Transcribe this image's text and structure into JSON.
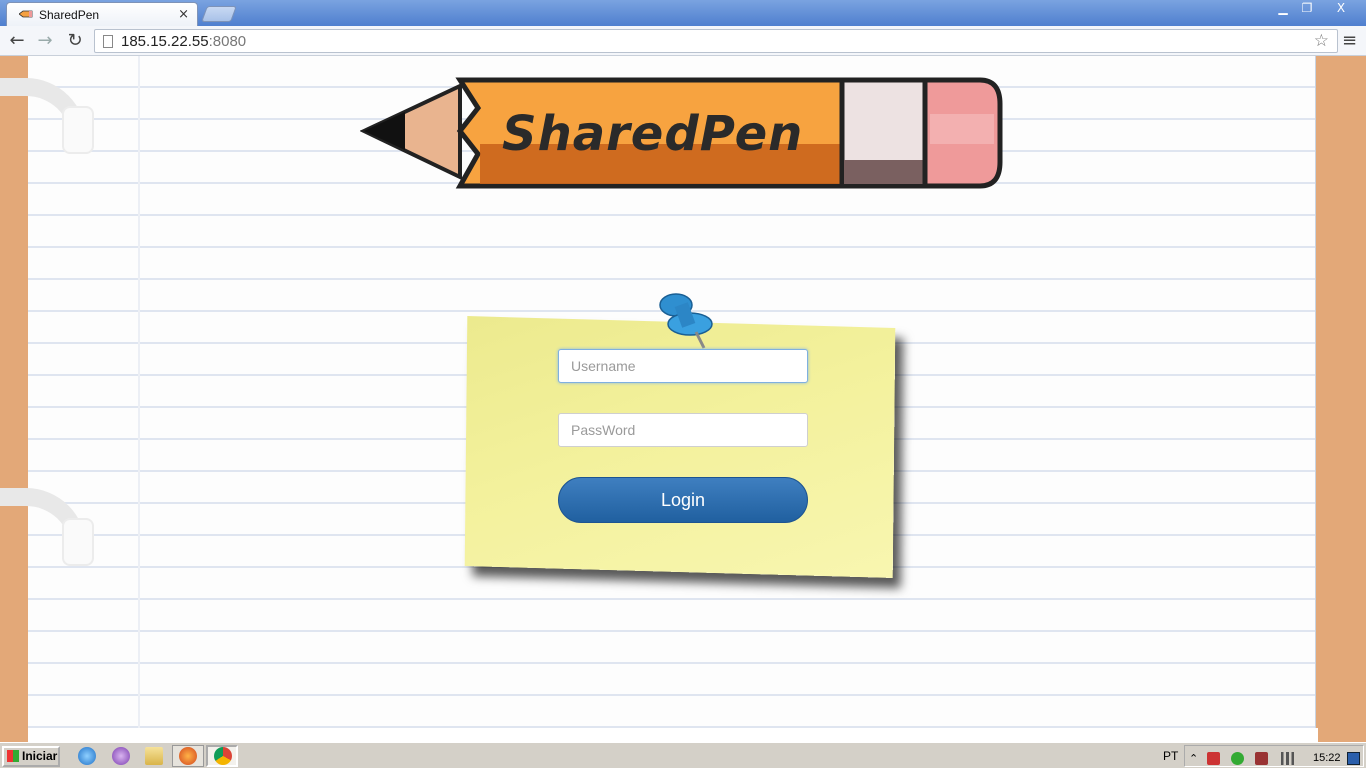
{
  "browser": {
    "tab_title": "SharedPen",
    "tab_close": "×",
    "url_host": "185.15.22.55",
    "url_port": ":8080",
    "window_controls": {
      "minimize": "▁",
      "restore": "❐",
      "close": "X"
    }
  },
  "logo": {
    "text": "SharedPen"
  },
  "login": {
    "username_placeholder": "Username",
    "password_placeholder": "PassWord",
    "button_label": "Login"
  },
  "taskbar": {
    "start_label": "Iniciar",
    "language": "PT",
    "clock": "15:22"
  },
  "icons": [
    "sharedpen-favicon-icon",
    "back-icon",
    "forward-icon",
    "reload-icon",
    "page-icon",
    "star-icon",
    "menu-icon",
    "pushpin-icon",
    "ie-icon",
    "viber-icon",
    "folder-icon",
    "firefox-icon",
    "chrome-icon"
  ],
  "colors": {
    "pencil_body": "#f7a340",
    "note": "#f3f19c",
    "login_button": "#2a6aab",
    "notebook_cover": "#e3a878"
  }
}
